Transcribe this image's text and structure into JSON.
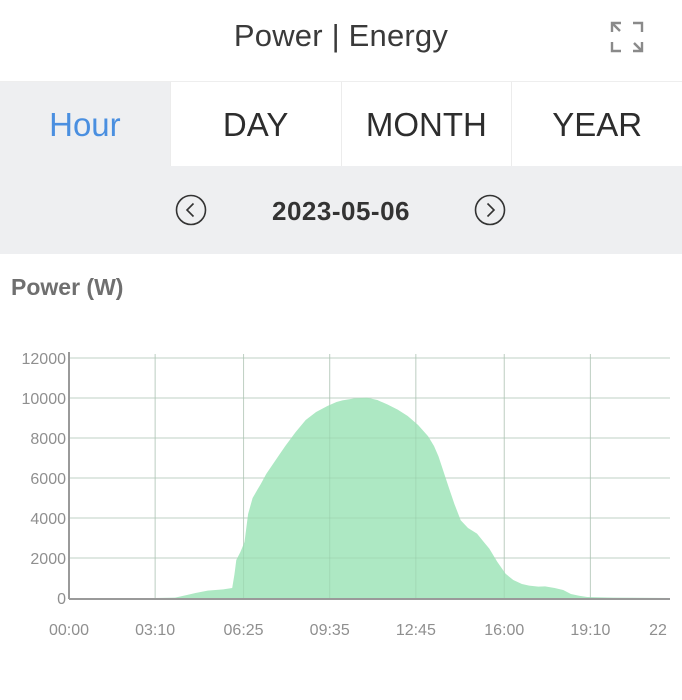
{
  "header": {
    "title": "Power | Energy",
    "expand_icon": "expand-icon"
  },
  "tabs": [
    {
      "label": "Hour",
      "active": true
    },
    {
      "label": "DAY",
      "active": false
    },
    {
      "label": "MONTH",
      "active": false
    },
    {
      "label": "YEAR",
      "active": false
    }
  ],
  "date_nav": {
    "date": "2023-05-06",
    "prev_icon": "chevron-left-circle-icon",
    "next_icon": "chevron-right-circle-icon"
  },
  "colors": {
    "accent": "#4a8fe0",
    "area_fill": "#ade8c3",
    "grid": "#d9d9d9",
    "axis": "#9a9a9a"
  },
  "chart_data": {
    "type": "area",
    "title": "Power (W)",
    "xlabel": "",
    "ylabel": "Power (W)",
    "ylim": [
      0,
      12000
    ],
    "xlim_minutes": [
      0,
      1330
    ],
    "yticks": [
      0,
      2000,
      4000,
      6000,
      8000,
      10000,
      12000
    ],
    "ytick_labels": [
      "0",
      "2000",
      "4000",
      "6000",
      "8000",
      "10000",
      "12000"
    ],
    "xticks_minutes": [
      0,
      190,
      385,
      575,
      765,
      960,
      1150,
      1330
    ],
    "xtick_labels": [
      "00:00",
      "03:10",
      "06:25",
      "09:35",
      "12:45",
      "16:00",
      "19:10",
      "22"
    ],
    "grid": true,
    "series": [
      {
        "name": "Power",
        "x_minutes": [
          0,
          190,
          234,
          260,
          279,
          306,
          340,
          360,
          365,
          369,
          378,
          387,
          395,
          405,
          415,
          423,
          435,
          450,
          465,
          477,
          500,
          522,
          545,
          570,
          590,
          603,
          630,
          657,
          680,
          702,
          725,
          747,
          770,
          792,
          805,
          815,
          825,
          837,
          850,
          864,
          880,
          900,
          915,
          927,
          945,
          963,
          980,
          999,
          1015,
          1035,
          1050,
          1071,
          1090,
          1107,
          1125,
          1143,
          1200,
          1330
        ],
        "values": [
          0,
          0,
          20,
          150,
          250,
          370,
          430,
          500,
          1200,
          1900,
          2300,
          2800,
          4200,
          5000,
          5400,
          5700,
          6200,
          6700,
          7200,
          7600,
          8300,
          8900,
          9300,
          9600,
          9800,
          9880,
          9980,
          10020,
          9900,
          9680,
          9420,
          9100,
          8650,
          8090,
          7600,
          7080,
          6400,
          5570,
          4700,
          3890,
          3500,
          3220,
          2800,
          2470,
          1800,
          1210,
          900,
          700,
          620,
          570,
          580,
          500,
          400,
          200,
          110,
          50,
          20,
          0
        ]
      }
    ]
  }
}
